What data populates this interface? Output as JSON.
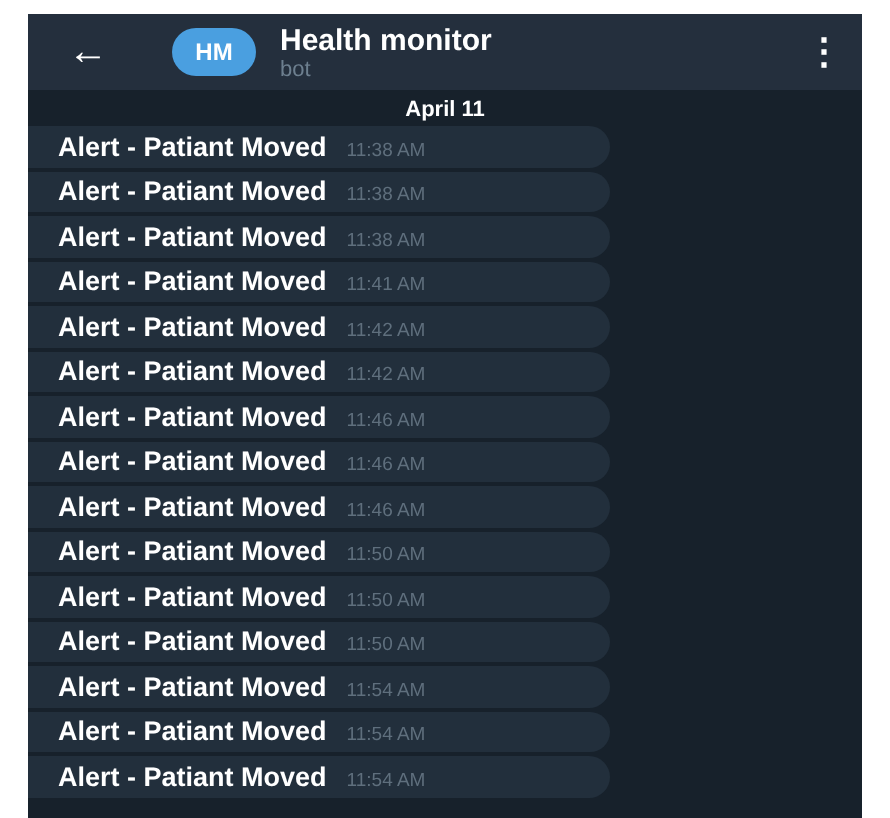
{
  "header": {
    "back": "←",
    "avatar": "HM",
    "title": "Health monitor",
    "subtitle": "bot",
    "menu": "⋮"
  },
  "date": "April 11",
  "messages": [
    {
      "text": "Alert - Patiant Moved",
      "time": "11:38 AM"
    },
    {
      "text": "Alert - Patiant Moved",
      "time": "11:38 AM"
    },
    {
      "text": "Alert - Patiant Moved",
      "time": "11:38 AM"
    },
    {
      "text": "Alert - Patiant Moved",
      "time": "11:41 AM"
    },
    {
      "text": "Alert - Patiant Moved",
      "time": "11:42 AM"
    },
    {
      "text": "Alert - Patiant Moved",
      "time": "11:42 AM"
    },
    {
      "text": "Alert - Patiant Moved",
      "time": "11:46 AM"
    },
    {
      "text": "Alert - Patiant Moved",
      "time": "11:46 AM"
    },
    {
      "text": "Alert - Patiant Moved",
      "time": "11:46 AM"
    },
    {
      "text": "Alert - Patiant Moved",
      "time": "11:50 AM"
    },
    {
      "text": "Alert - Patiant Moved",
      "time": "11:50 AM"
    },
    {
      "text": "Alert - Patiant Moved",
      "time": "11:50 AM"
    },
    {
      "text": "Alert - Patiant Moved",
      "time": "11:54 AM"
    },
    {
      "text": "Alert - Patiant Moved",
      "time": "11:54 AM"
    },
    {
      "text": "Alert - Patiant Moved",
      "time": "11:54 AM"
    }
  ]
}
